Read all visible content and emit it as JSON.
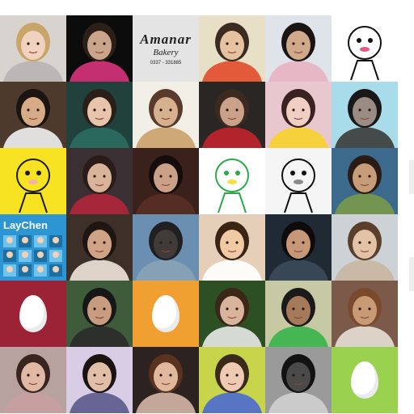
{
  "page": {
    "title": ""
  },
  "egg_color": "#ffffff",
  "tiles": [
    {
      "kind": "photo",
      "icon": "portrait-blonde-girl",
      "bg": "#d9d3cf",
      "skin": "#f0d2bf",
      "hair": "#c9a56a",
      "fg": "#b9b2b2"
    },
    {
      "kind": "photo",
      "icon": "two-guys-photo",
      "bg": "#0c0c0c",
      "skin": "#caa58c",
      "hair": "#2b1f18",
      "fg": "#d8337b"
    },
    {
      "kind": "text",
      "icon": "bakery-logo",
      "bg": "#e4e4e4",
      "brand": "Amanar",
      "subtitle": "Bakery",
      "phone": "0337 - 331885"
    },
    {
      "kind": "photo",
      "icon": "group-anime-photo",
      "bg": "#e8dfc7",
      "skin": "#e6c3a0",
      "hair": "#3b2b20",
      "fg": "#e24b2b"
    },
    {
      "kind": "photo",
      "icon": "couple-selfie",
      "bg": "#dfe3ea",
      "skin": "#d0a98a",
      "hair": "#1a1412",
      "fg": "#e7b2c2"
    },
    {
      "kind": "drawing",
      "icon": "skeleton-drawing",
      "bg": "#ffffff",
      "fg": "#111111",
      "accent": "#e65a82"
    },
    {
      "kind": "photo",
      "icon": "guitar-boy",
      "bg": "#4e3a2c",
      "skin": "#d6ab86",
      "hair": "#1b1410",
      "fg": "#f2f2f2"
    },
    {
      "kind": "photo",
      "icon": "green-eyed-girl",
      "bg": "#21413c",
      "skin": "#e7c4ab",
      "hair": "#2a1e18",
      "fg": "#2b6b60"
    },
    {
      "kind": "photo",
      "icon": "double-exposure-photo",
      "bg": "#f2efe6",
      "skin": "#d6b18e",
      "hair": "#5a3a2c",
      "fg": "#caa06a"
    },
    {
      "kind": "photo",
      "icon": "soccer-player",
      "bg": "#2a2624",
      "skin": "#caa28a",
      "hair": "#3a2a20",
      "fg": "#c2232c"
    },
    {
      "kind": "photo",
      "icon": "flower-face-girl",
      "bg": "#e8c7cf",
      "skin": "#efcfc3",
      "hair": "#3a2220",
      "fg": "#f7d12a"
    },
    {
      "kind": "photo",
      "icon": "shoes-on-water",
      "bg": "#a9dceb",
      "skin": "#9a8c84",
      "hair": "#181818",
      "fg": "#3a3a3a"
    },
    {
      "kind": "drawing",
      "icon": "cartoon-boy",
      "bg": "#f7e322",
      "fg": "#1b1b1b",
      "accent": "#f4b3a8"
    },
    {
      "kind": "photo",
      "icon": "red-scarf-girl",
      "bg": "#3a2f33",
      "skin": "#d9b49b",
      "hair": "#2a1c19",
      "fg": "#b2263a"
    },
    {
      "kind": "photo",
      "icon": "sleeping-boy",
      "bg": "#3a211b",
      "skin": "#caa087",
      "hair": "#140d0b",
      "fg": "#5a2f25"
    },
    {
      "kind": "drawing",
      "icon": "keroro-frog",
      "bg": "#ffffff",
      "fg": "#2aa84a",
      "accent": "#f2e142"
    },
    {
      "kind": "drawing",
      "icon": "anime-character-sketch",
      "bg": "#f5f5f5",
      "fg": "#111111",
      "accent": "#8a8a8a"
    },
    {
      "kind": "photo",
      "icon": "girl-on-grass",
      "bg": "#3b6a8d",
      "skin": "#c79c78",
      "hair": "#2a1c14",
      "fg": "#7a9a4a"
    },
    {
      "kind": "text",
      "icon": "laychen-poster",
      "bg": "#2d96d2",
      "brand": "LayChen",
      "subtitle": "",
      "phone": ""
    },
    {
      "kind": "photo",
      "icon": "couple-close-up",
      "bg": "#3c3029",
      "skin": "#d0a386",
      "hair": "#1f1612",
      "fg": "#f0e6da"
    },
    {
      "kind": "photo",
      "icon": "man-by-the-sea",
      "bg": "#6b8fb0",
      "skin": "#403a38",
      "hair": "#202020",
      "fg": "#8aa3b6"
    },
    {
      "kind": "photo",
      "icon": "smiling-asian-girl",
      "bg": "#e6cfb8",
      "skin": "#f0caa5",
      "hair": "#3a2414",
      "fg": "#ffffff"
    },
    {
      "kind": "photo",
      "icon": "dark-haired-girl",
      "bg": "#1f2a35",
      "skin": "#c79877",
      "hair": "#0e0b0a",
      "fg": "#3a4a5a"
    },
    {
      "kind": "photo",
      "icon": "smiling-guy",
      "bg": "#cdd2d6",
      "skin": "#e3c3a8",
      "hair": "#5a3f2c",
      "fg": "#c9b7a3"
    },
    {
      "kind": "egg",
      "icon": "default-egg-avatar",
      "bg": "#9b2335"
    },
    {
      "kind": "photo",
      "icon": "guy-with-sunglasses",
      "bg": "#3e5b3a",
      "skin": "#c89c7e",
      "hair": "#171717",
      "fg": "#2a2a2a"
    },
    {
      "kind": "egg",
      "icon": "default-egg-avatar",
      "bg": "#f0a030"
    },
    {
      "kind": "photo",
      "icon": "girl-in-forest",
      "bg": "#2d4f24",
      "skin": "#d9b49c",
      "hair": "#3a2718",
      "fg": "#e9e9e9"
    },
    {
      "kind": "photo",
      "icon": "guy-in-green-shirt",
      "bg": "#c7c8a4",
      "skin": "#a57a5a",
      "hair": "#1a1a1a",
      "fg": "#37b34a"
    },
    {
      "kind": "photo",
      "icon": "statue-mirror",
      "bg": "#7c5a4a",
      "skin": "#c89a76",
      "hair": "#7a4a2c",
      "fg": "#e8dfd6"
    },
    {
      "kind": "photo",
      "icon": "girl-with-long-hair",
      "bg": "#b8a2a0",
      "skin": "#e0b8a4",
      "hair": "#3a2420",
      "fg": "#c8a0a0"
    },
    {
      "kind": "photo",
      "icon": "group-of-friends",
      "bg": "#d9cde6",
      "skin": "#e1bea8",
      "hair": "#1b1212",
      "fg": "#5a5a8a"
    },
    {
      "kind": "photo",
      "icon": "brunette-selfie",
      "bg": "#2c2320",
      "skin": "#e0b89c",
      "hair": "#5a3320",
      "fg": "#d4b7a6"
    },
    {
      "kind": "photo",
      "icon": "colorful-selfie",
      "bg": "#c8d44a",
      "skin": "#eec9b4",
      "hair": "#3a2a1a",
      "fg": "#4a6ad0"
    },
    {
      "kind": "photo",
      "icon": "bw-guy-portrait",
      "bg": "#9a9a9a",
      "skin": "#4a4a4a",
      "hair": "#121212",
      "fg": "#d0d0d0"
    },
    {
      "kind": "egg",
      "icon": "default-egg-avatar",
      "bg": "#9ad250"
    }
  ]
}
